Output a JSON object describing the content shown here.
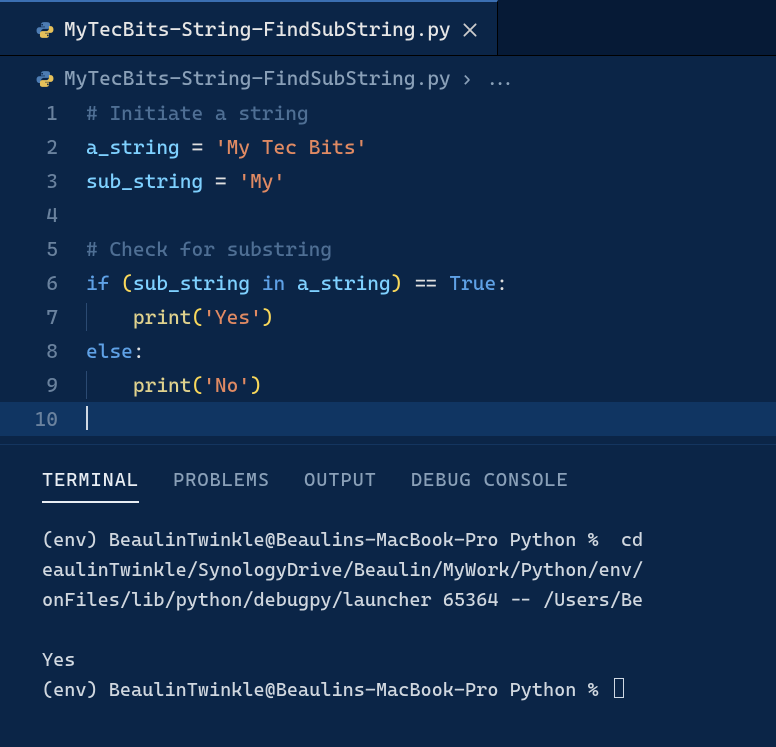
{
  "tab": {
    "filename": "MyTecBits-String-FindSubString.py"
  },
  "breadcrumb": {
    "filename": "MyTecBits-String-FindSubString.py",
    "chevron": "›",
    "rest": "..."
  },
  "code": {
    "lines": [
      {
        "num": "1",
        "tokens": [
          [
            "comment",
            "# Initiate a string"
          ]
        ]
      },
      {
        "num": "2",
        "tokens": [
          [
            "ident",
            "a_string"
          ],
          [
            "op",
            " = "
          ],
          [
            "string",
            "'My Tec Bits'"
          ]
        ]
      },
      {
        "num": "3",
        "tokens": [
          [
            "ident",
            "sub_string"
          ],
          [
            "op",
            " = "
          ],
          [
            "string",
            "'My'"
          ]
        ]
      },
      {
        "num": "4",
        "tokens": []
      },
      {
        "num": "5",
        "tokens": [
          [
            "comment",
            "# Check for substring"
          ]
        ]
      },
      {
        "num": "6",
        "tokens": [
          [
            "keyword",
            "if"
          ],
          [
            "op",
            " "
          ],
          [
            "paren",
            "("
          ],
          [
            "ident",
            "sub_string"
          ],
          [
            "op",
            " "
          ],
          [
            "keyword",
            "in"
          ],
          [
            "op",
            " "
          ],
          [
            "ident",
            "a_string"
          ],
          [
            "paren",
            ")"
          ],
          [
            "op",
            " == "
          ],
          [
            "const",
            "True"
          ],
          [
            "colon",
            ":"
          ]
        ]
      },
      {
        "num": "7",
        "indent": 1,
        "tokens": [
          [
            "op",
            "    "
          ],
          [
            "func",
            "print"
          ],
          [
            "paren",
            "("
          ],
          [
            "string",
            "'Yes'"
          ],
          [
            "paren",
            ")"
          ]
        ]
      },
      {
        "num": "8",
        "tokens": [
          [
            "keyword",
            "else"
          ],
          [
            "colon",
            ":"
          ]
        ]
      },
      {
        "num": "9",
        "indent": 1,
        "tokens": [
          [
            "op",
            "    "
          ],
          [
            "func",
            "print"
          ],
          [
            "paren",
            "("
          ],
          [
            "string",
            "'No'"
          ],
          [
            "paren",
            ")"
          ]
        ]
      },
      {
        "num": "10",
        "cursor": true,
        "tokens": []
      }
    ]
  },
  "panel": {
    "tabs": {
      "terminal": "TERMINAL",
      "problems": "PROBLEMS",
      "output": "OUTPUT",
      "debug_console": "DEBUG CONSOLE"
    },
    "active": "terminal"
  },
  "terminal": {
    "line1": "(env) BeaulinTwinkle@Beaulins-MacBook-Pro Python %  cd",
    "line2": "eaulinTwinkle/SynologyDrive/Beaulin/MyWork/Python/env/",
    "line3": "onFiles/lib/python/debugpy/launcher 65364 -- /Users/Be",
    "blank": "",
    "output": "Yes",
    "prompt": "(env) BeaulinTwinkle@Beaulins-MacBook-Pro Python % "
  }
}
